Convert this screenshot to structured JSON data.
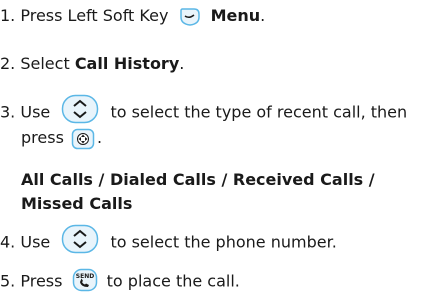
{
  "steps": [
    {
      "num": "1.",
      "text_before": "Press Left Soft Key",
      "bold_label": "Menu",
      "text_after": "."
    },
    {
      "num": "2.",
      "text_before": "Select",
      "bold_label": "Call History",
      "text_after": "."
    },
    {
      "num": "3.",
      "text_before": "Use",
      "text_middle": "to select the type of recent call, then",
      "line2_before": "press",
      "line2_after": "."
    },
    {
      "options_line1": "All Calls / Dialed Calls / Received Calls /",
      "options_line2": "Missed Calls"
    },
    {
      "num": "4.",
      "text_before": "Use",
      "text_after": "to select the phone number."
    },
    {
      "num": "5.",
      "text_before": "Press",
      "text_after": "to place the call."
    }
  ],
  "icons": {
    "soft_key": "left-soft-key-icon",
    "nav_key": "navigation-key-icon",
    "ok_key": "ok-key-icon",
    "send_key": "send-key-icon"
  },
  "colors": {
    "text": "#1a1a1a",
    "icon_stroke": "#5bb7e6",
    "icon_fill": "#e9f4fb"
  }
}
